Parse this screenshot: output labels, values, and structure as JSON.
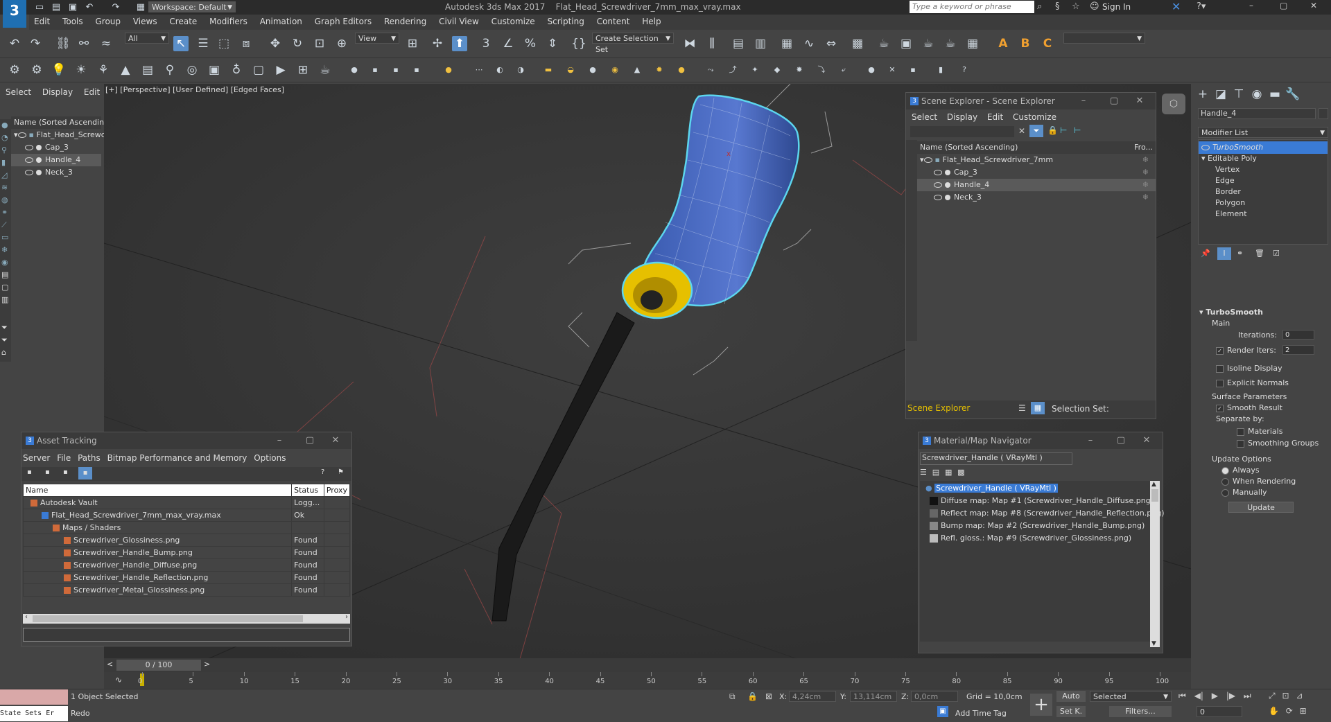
{
  "app": {
    "title": "Autodesk 3ds Max 2017",
    "file": "Flat_Head_Screwdriver_7mm_max_vray.max",
    "workspace_label": "Workspace: Default",
    "search_placeholder": "Type a keyword or phrase",
    "sign_in": "Sign In"
  },
  "menu": [
    "Edit",
    "Tools",
    "Group",
    "Views",
    "Create",
    "Modifiers",
    "Animation",
    "Graph Editors",
    "Rendering",
    "Civil View",
    "Customize",
    "Scripting",
    "Content",
    "Help"
  ],
  "toolbar": {
    "filter_all": "All",
    "view": "View",
    "selection_set": "Create Selection Set"
  },
  "left_panel": {
    "tabs": [
      "Select",
      "Display",
      "Edit"
    ],
    "header": "Name (Sorted Ascending)",
    "root": "Flat_Head_Screwc",
    "items": [
      "Cap_3",
      "Handle_4",
      "Neck_3"
    ]
  },
  "viewport": {
    "label": "[+] [Perspective] [User Defined] [Edged Faces]"
  },
  "scene_explorer": {
    "title": "Scene Explorer - Scene Explorer",
    "menu": [
      "Select",
      "Display",
      "Edit",
      "Customize"
    ],
    "header_name": "Name (Sorted Ascending)",
    "header_col": "Fro...",
    "root": "Flat_Head_Screwdriver_7mm",
    "items": [
      "Cap_3",
      "Handle_4",
      "Neck_3"
    ],
    "footer_name": "Scene Explorer",
    "footer_sel": "Selection Set:"
  },
  "asset_tracking": {
    "title": "Asset Tracking",
    "menu": [
      "Server",
      "File",
      "Paths",
      "Bitmap Performance and Memory",
      "Options"
    ],
    "columns": [
      "Name",
      "Status",
      "Proxy"
    ],
    "rows": [
      {
        "name": "Autodesk Vault",
        "status": "Logg..."
      },
      {
        "name": "Flat_Head_Screwdriver_7mm_max_vray.max",
        "status": "Ok"
      },
      {
        "name": "Maps / Shaders",
        "status": ""
      },
      {
        "name": "Screwdriver_Glossiness.png",
        "status": "Found"
      },
      {
        "name": "Screwdriver_Handle_Bump.png",
        "status": "Found"
      },
      {
        "name": "Screwdriver_Handle_Diffuse.png",
        "status": "Found"
      },
      {
        "name": "Screwdriver_Handle_Reflection.png",
        "status": "Found"
      },
      {
        "name": "Screwdriver_Metal_Glossiness.png",
        "status": "Found"
      }
    ]
  },
  "material_nav": {
    "title": "Material/Map Navigator",
    "field": "Screwdriver_Handle  ( VRayMtl )",
    "root": "Screwdriver_Handle  ( VRayMtl )",
    "maps": [
      "Diffuse map: Map #1 (Screwdriver_Handle_Diffuse.png)",
      "Reflect map: Map #8 (Screwdriver_Handle_Reflection.png)",
      "Bump map: Map #2 (Screwdriver_Handle_Bump.png)",
      "Refl. gloss.: Map #9 (Screwdriver_Glossiness.png)"
    ]
  },
  "command_panel": {
    "object_name": "Handle_4",
    "modifier_list": "Modifier List",
    "stack": [
      "TurboSmooth",
      "Editable Poly",
      "Vertex",
      "Edge",
      "Border",
      "Polygon",
      "Element"
    ],
    "rollout_title": "TurboSmooth",
    "main": "Main",
    "iterations_label": "Iterations:",
    "iterations": "0",
    "render_iters_label": "Render Iters:",
    "render_iters": "2",
    "isoline": "Isoline Display",
    "explicit_normals": "Explicit Normals",
    "surface_params": "Surface Parameters",
    "smooth_result": "Smooth Result",
    "separate_by": "Separate by:",
    "materials": "Materials",
    "smoothing_groups": "Smoothing Groups",
    "update_options": "Update Options",
    "always": "Always",
    "when_rendering": "When Rendering",
    "manually": "Manually",
    "update": "Update"
  },
  "timeline": {
    "frame": "0 / 100",
    "ticks": [
      "0",
      "5",
      "10",
      "15",
      "20",
      "25",
      "30",
      "35",
      "40",
      "45",
      "50",
      "55",
      "60",
      "65",
      "70",
      "75",
      "80",
      "85",
      "90",
      "95",
      "100"
    ]
  },
  "status": {
    "state_sets": "State Sets Er",
    "selected": "1 Object Selected",
    "redo": "Redo",
    "x_label": "X:",
    "x": "4,24cm",
    "y_label": "Y:",
    "y": "13,114cm",
    "z_label": "Z:",
    "z": "0,0cm",
    "grid": "Grid = 10,0cm",
    "add_time_tag": "Add Time Tag",
    "auto": "Auto",
    "set_key": "Set K.",
    "selected_dd": "Selected",
    "filters": "Filters...",
    "frame_field": "0"
  }
}
